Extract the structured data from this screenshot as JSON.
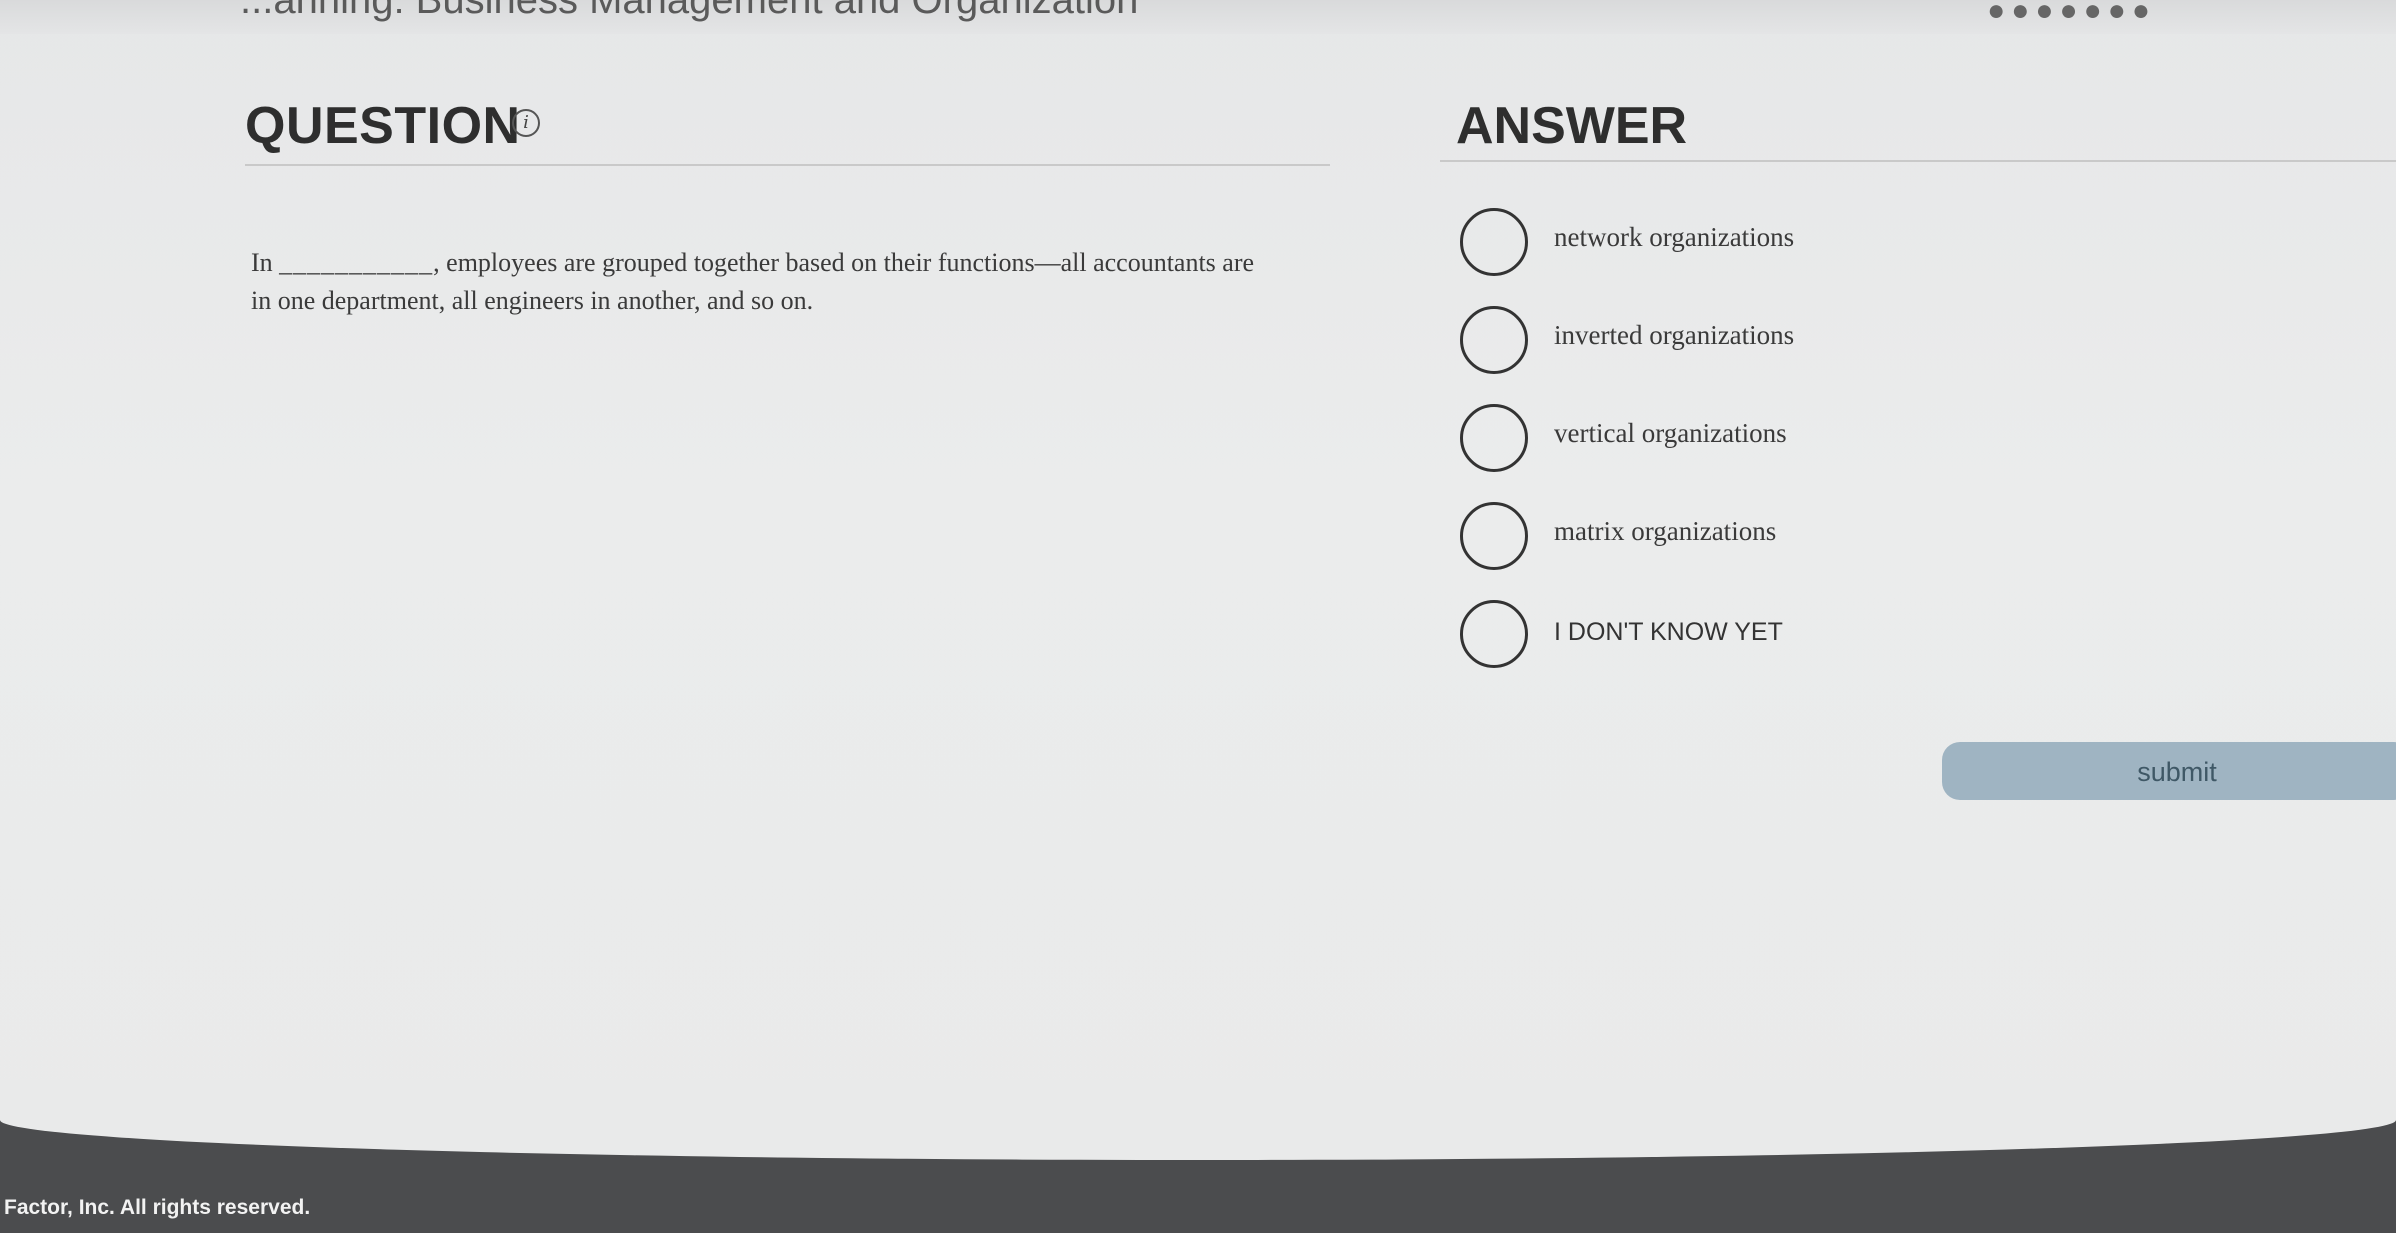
{
  "top_strip": {
    "partial_title": "...anning: Business Management and Organization",
    "right_fragment": "●●●●●●●"
  },
  "question": {
    "heading": "QUESTION",
    "info_icon_glyph": "i",
    "text_before_blank": "In ",
    "blank": "___________",
    "text_after_blank": ", employees are grouped together based on their functions—all accountants are in one department, all engineers in another, and so on."
  },
  "answer": {
    "heading": "ANSWER",
    "options": [
      {
        "label": "network organizations"
      },
      {
        "label": "inverted organizations"
      },
      {
        "label": "vertical organizations"
      },
      {
        "label": "matrix organizations"
      },
      {
        "label": "I DON'T KNOW YET"
      }
    ]
  },
  "submit": {
    "label": "submit",
    "color": "#9fb4c2"
  },
  "footer": {
    "text": "Factor, Inc. All rights reserved."
  }
}
